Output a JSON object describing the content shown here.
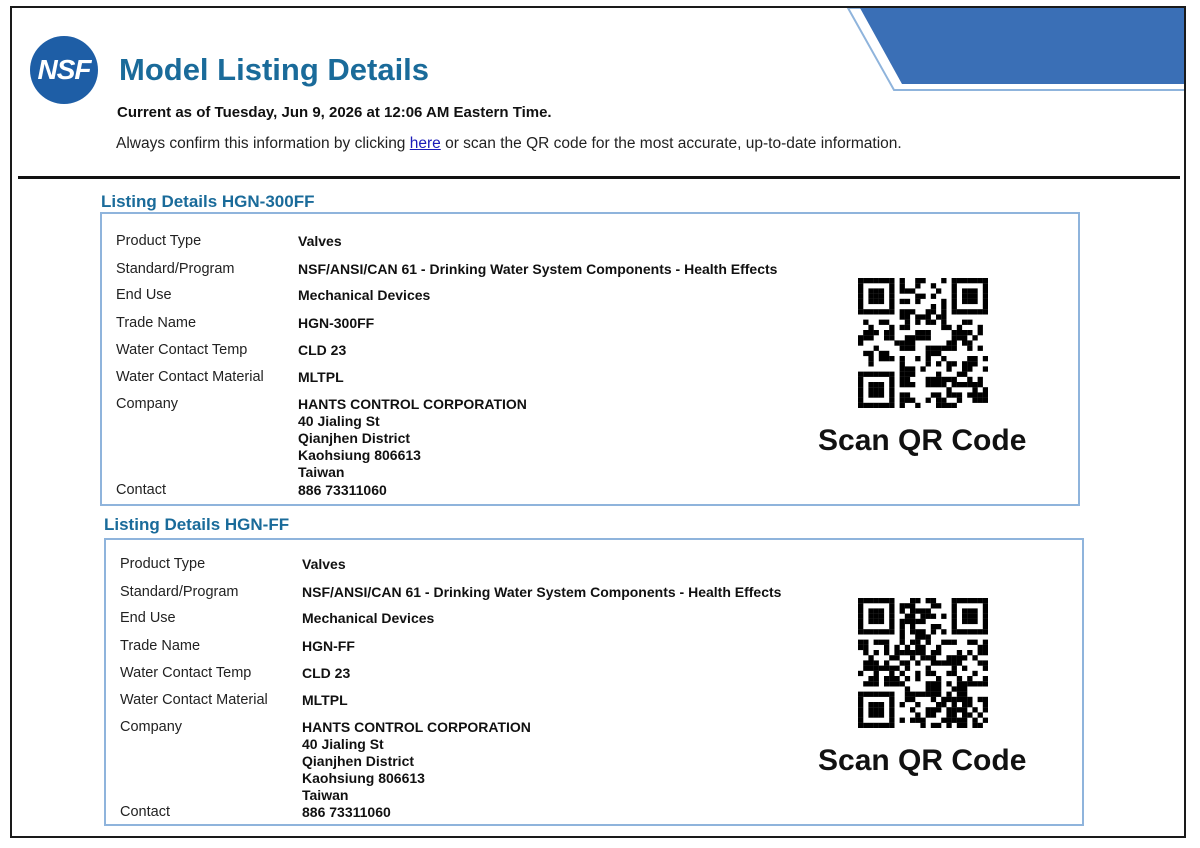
{
  "header": {
    "logo_text": "NSF",
    "title": "Model Listing Details",
    "current_as_of": "Current as of Tuesday, Jun 9, 2026 at 12:06 AM Eastern Time.",
    "confirm_prefix": "Always confirm this information by clicking ",
    "confirm_link": "here",
    "confirm_suffix": " or scan the QR code for the  most accurate, up-to-date information.",
    "banner_color": "#3a6fb6"
  },
  "listings": [
    {
      "heading": "Listing Details HGN-300FF",
      "labels": {
        "product_type": "Product Type",
        "standard": "Standard/Program",
        "end_use": "End Use",
        "trade_name": "Trade Name",
        "temp": "Water Contact Temp",
        "material": "Water Contact Material",
        "company": "Company",
        "contact": "Contact"
      },
      "values": {
        "product_type": "Valves",
        "standard": "NSF/ANSI/CAN 61 - Drinking Water System Components - Health Effects",
        "end_use": "Mechanical Devices",
        "trade_name": "HGN-300FF",
        "temp": "CLD 23",
        "material": "MLTPL",
        "company_lines": [
          "HANTS CONTROL CORPORATION",
          "40 Jialing St",
          "Qianjhen District",
          "Kaohsiung 806613",
          "Taiwan"
        ],
        "contact": "886 73311060"
      },
      "qr_caption": "Scan QR Code"
    },
    {
      "heading": "Listing Details HGN-FF",
      "labels": {
        "product_type": "Product Type",
        "standard": "Standard/Program",
        "end_use": "End Use",
        "trade_name": "Trade Name",
        "temp": "Water Contact Temp",
        "material": "Water Contact Material",
        "company": "Company",
        "contact": "Contact"
      },
      "values": {
        "product_type": "Valves",
        "standard": "NSF/ANSI/CAN 61 - Drinking Water System Components - Health Effects",
        "end_use": "Mechanical Devices",
        "trade_name": "HGN-FF",
        "temp": "CLD 23",
        "material": "MLTPL",
        "company_lines": [
          "HANTS CONTROL CORPORATION",
          "40 Jialing St",
          "Qianjhen District",
          "Kaohsiung 806613",
          "Taiwan"
        ],
        "contact": "886 73311060"
      },
      "qr_caption": "Scan QR Code"
    }
  ]
}
